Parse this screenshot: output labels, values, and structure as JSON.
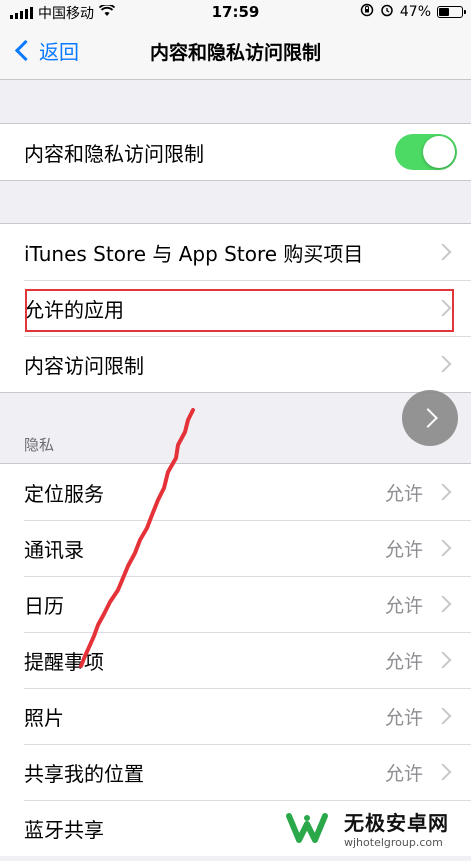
{
  "status_bar": {
    "carrier": "中国移动",
    "time": "17:59",
    "battery": "47%",
    "battery_level": 0.47
  },
  "nav": {
    "back_label": "返回",
    "title": "内容和隐私访问限制"
  },
  "toggle_row": {
    "label": "内容和隐私访问限制",
    "enabled": true
  },
  "restrictions": [
    {
      "label": "iTunes Store 与 App Store 购买项目"
    },
    {
      "label": "允许的应用"
    },
    {
      "label": "内容访问限制"
    }
  ],
  "privacy": {
    "header": "隐私",
    "items": [
      {
        "label": "定位服务",
        "value": "允许"
      },
      {
        "label": "通讯录",
        "value": "允许"
      },
      {
        "label": "日历",
        "value": "允许"
      },
      {
        "label": "提醒事项",
        "value": "允许"
      },
      {
        "label": "照片",
        "value": "允许"
      },
      {
        "label": "共享我的位置",
        "value": "允许"
      },
      {
        "label": "蓝牙共享",
        "value": ""
      }
    ]
  },
  "watermark": {
    "title": "无极安卓网",
    "url": "wjhotelgroup.com"
  },
  "colors": {
    "accent": "#0a7aff",
    "toggle_on": "#4cd964",
    "annotation": "#e0363a"
  }
}
